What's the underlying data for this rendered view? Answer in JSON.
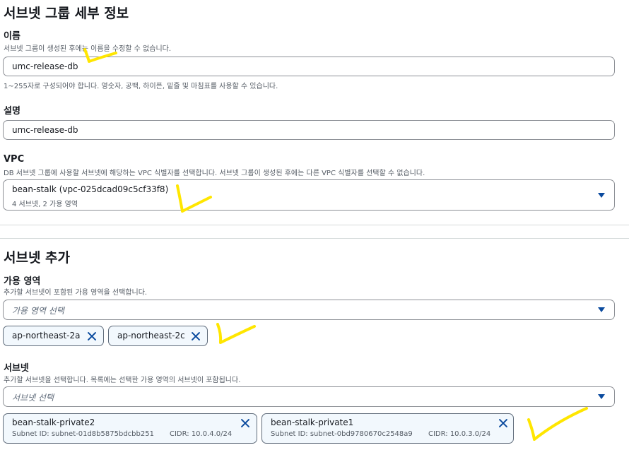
{
  "details": {
    "heading": "서브넷 그룹 세부 정보",
    "name": {
      "label": "이름",
      "description": "서브넷 그룹이 생성된 후에는 이름을 수정할 수 없습니다.",
      "value": "umc-release-db",
      "constraint": "1~255자로 구성되어야 합니다. 영숫자, 공백, 하이픈, 밑줄 및 마침표를 사용할 수 있습니다."
    },
    "description_field": {
      "label": "설명",
      "value": "umc-release-db"
    },
    "vpc": {
      "label": "VPC",
      "description": "DB 서브넷 그룹에 사용할 서브넷에 해당하는 VPC 식별자를 선택합니다. 서브넷 그룹이 생성된 후에는 다른 VPC 식별자를 선택할 수 없습니다.",
      "selected": "bean-stalk (vpc-025dcad09c5cf33f8)",
      "selected_detail": "4 서브넷, 2 가용 영역"
    }
  },
  "add_subnets": {
    "heading": "서브넷 추가",
    "availability_zones": {
      "label": "가용 영역",
      "description": "추가할 서브넷이 포함된 가용 영역을 선택합니다.",
      "placeholder": "가용 영역 선택",
      "tokens": [
        "ap-northeast-2a",
        "ap-northeast-2c"
      ]
    },
    "subnets": {
      "label": "서브넷",
      "description": "추가할 서브넷을 선택합니다. 목록에는 선택한 가용 영역의 서브넷이 포함됩니다.",
      "placeholder": "서브넷 선택",
      "tokens": [
        {
          "name": "bean-stalk-private2",
          "subnet_id": "Subnet ID: subnet-01d8b5875bdcbb251",
          "cidr": "CIDR: 10.0.4.0/24"
        },
        {
          "name": "bean-stalk-private1",
          "subnet_id": "Subnet ID: subnet-0bd9780670c2548a9",
          "cidr": "CIDR: 10.0.3.0/24"
        }
      ]
    }
  },
  "colors": {
    "accent": "#0a4a9e",
    "annotation": "#ffe600",
    "border": "#8d9096"
  },
  "icons": {
    "dropdown": "caret-down-icon",
    "remove": "close-icon",
    "annotation": "checkmark-icon"
  }
}
